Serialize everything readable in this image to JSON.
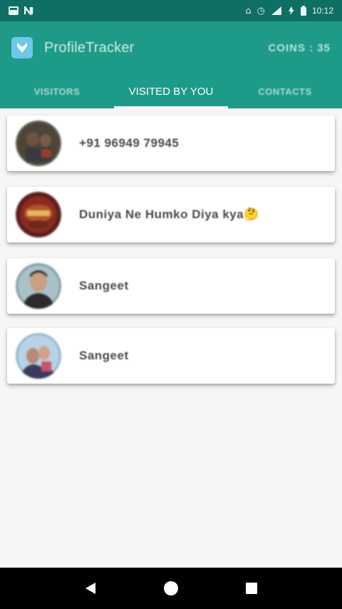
{
  "status_bar": {
    "time": "10:12",
    "left_icons": [
      "gallery-icon",
      "notification-n-icon"
    ],
    "right_icons": [
      "cast-icon",
      "alarm-icon",
      "signal-icon",
      "wifi-icon",
      "battery-icon"
    ]
  },
  "app_bar": {
    "logo_icon": "app-logo-icon",
    "title": "ProfileTracker",
    "coins": "COINS : 35",
    "color": "#1e9a88"
  },
  "tabs": [
    {
      "label": "VISITORS",
      "active": false
    },
    {
      "label": "VISITED BY YOU",
      "active": true
    },
    {
      "label": "CONTACTS",
      "active": false
    }
  ],
  "visited_list": [
    {
      "name": "+91 96949 79945"
    },
    {
      "name": "Duniya Ne Humko Diya kya🤔"
    },
    {
      "name": "Sangeet"
    },
    {
      "name": "Sangeet"
    }
  ],
  "nav_bar": {
    "buttons": [
      "back-icon",
      "home-icon",
      "recents-icon"
    ]
  }
}
